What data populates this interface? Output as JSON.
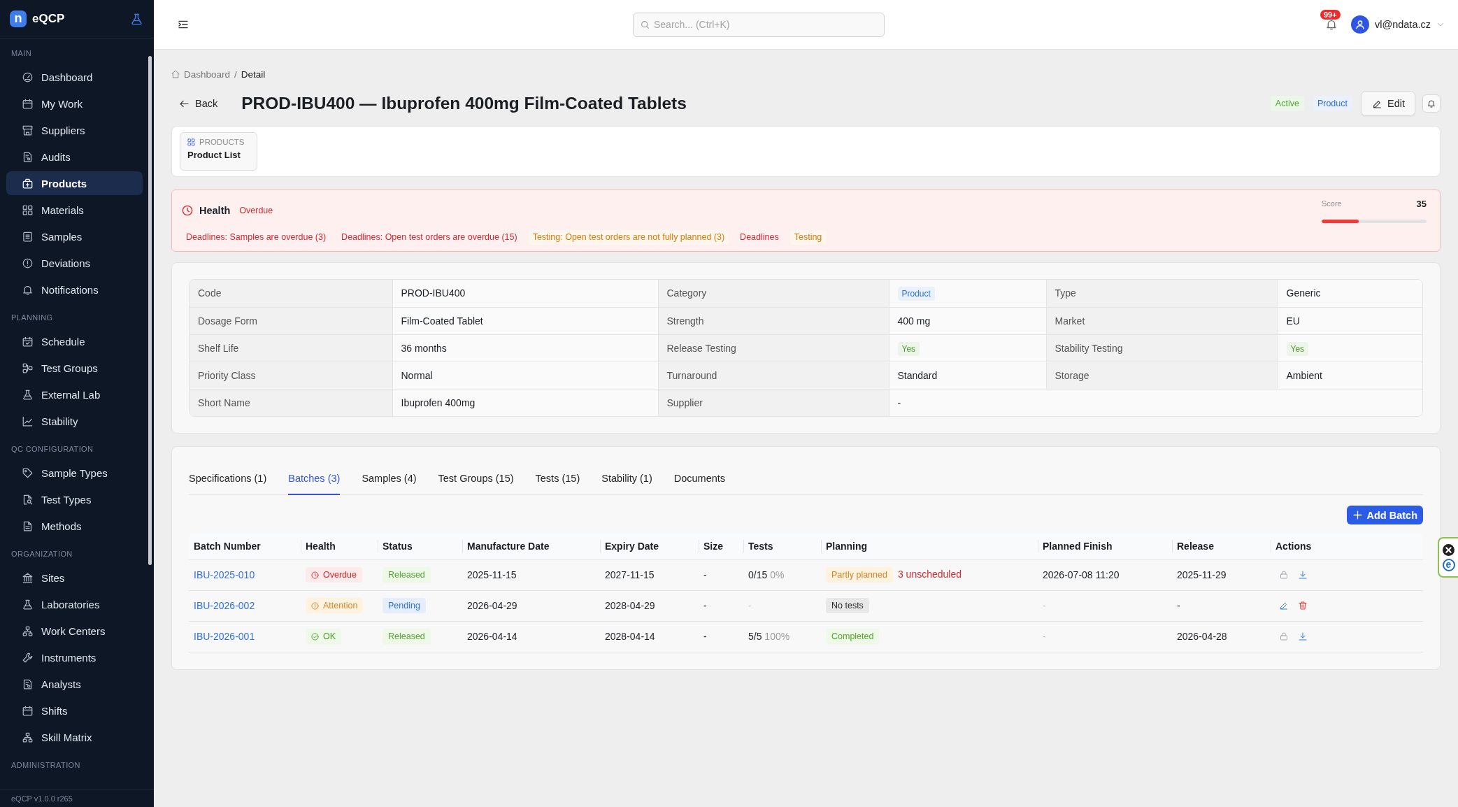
{
  "sidebar": {
    "logo_mark": "n",
    "app_name": "eQCP",
    "sections": [
      {
        "label": "MAIN",
        "items": [
          {
            "label": "Dashboard",
            "selected": false
          },
          {
            "label": "My Work",
            "selected": false
          },
          {
            "label": "Suppliers",
            "selected": false
          },
          {
            "label": "Audits",
            "selected": false
          },
          {
            "label": "Products",
            "selected": true
          },
          {
            "label": "Materials",
            "selected": false
          },
          {
            "label": "Samples",
            "selected": false
          },
          {
            "label": "Deviations",
            "selected": false
          },
          {
            "label": "Notifications",
            "selected": false
          }
        ]
      },
      {
        "label": "PLANNING",
        "items": [
          {
            "label": "Schedule",
            "selected": false
          },
          {
            "label": "Test Groups",
            "selected": false
          },
          {
            "label": "External Lab",
            "selected": false
          },
          {
            "label": "Stability",
            "selected": false
          }
        ]
      },
      {
        "label": "QC CONFIGURATION",
        "items": [
          {
            "label": "Sample Types",
            "selected": false
          },
          {
            "label": "Test Types",
            "selected": false
          },
          {
            "label": "Methods",
            "selected": false
          }
        ]
      },
      {
        "label": "ORGANIZATION",
        "items": [
          {
            "label": "Sites",
            "selected": false
          },
          {
            "label": "Laboratories",
            "selected": false
          },
          {
            "label": "Work Centers",
            "selected": false
          },
          {
            "label": "Instruments",
            "selected": false
          },
          {
            "label": "Analysts",
            "selected": false
          },
          {
            "label": "Shifts",
            "selected": false
          },
          {
            "label": "Skill Matrix",
            "selected": false
          }
        ]
      },
      {
        "label": "ADMINISTRATION"
      }
    ],
    "version": "eQCP v1.0.0 r265"
  },
  "topbar": {
    "search": {
      "placeholder": "Search... (Ctrl+K)"
    },
    "notification_count": "99+",
    "user": "vl@ndata.cz"
  },
  "breadcrumb": {
    "items": [
      "Dashboard",
      "Detail"
    ],
    "separator": "/"
  },
  "page": {
    "back": "Back",
    "title": "PROD-IBU400 — Ibuprofen 400mg Film-Coated Tablets",
    "badges": [
      {
        "label": "Active",
        "color": "#4ea82a"
      },
      {
        "label": "Product",
        "color": "#2f6fe4"
      }
    ],
    "edit": "Edit"
  },
  "subnav": {
    "section": "PRODUCTS",
    "link": "Product List"
  },
  "health": {
    "title": "Health",
    "status": "Overdue",
    "score_label": "Score",
    "score": "35",
    "level": 0.35,
    "issues": [
      {
        "text": "Deadlines: Samples are overdue (3)",
        "color": "#d9272e"
      },
      {
        "text": "Deadlines: Open test orders are overdue (15)",
        "color": "#d9272e"
      },
      {
        "text": "Testing: Open test orders are not fully planned (3)",
        "color": "#d97a06"
      },
      {
        "text": "Deadlines",
        "color": "#d9272e"
      },
      {
        "text": "Testing",
        "color": "#d97a06"
      }
    ]
  },
  "details": {
    "rows": [
      [
        {
          "label": "Code",
          "value": "PROD-IBU400",
          "kind": "text"
        },
        {
          "label": "Category",
          "value": "Product",
          "kind": "badge",
          "color": "#2f6fe4"
        },
        {
          "label": "Type",
          "value": "Generic",
          "kind": "text"
        }
      ],
      [
        {
          "label": "Dosage Form",
          "value": "Film-Coated Tablet",
          "kind": "text"
        },
        {
          "label": "Strength",
          "value": "400 mg",
          "kind": "text"
        },
        {
          "label": "Market",
          "value": "EU",
          "kind": "text"
        }
      ],
      [
        {
          "label": "Shelf Life",
          "value": "36 months",
          "kind": "text"
        },
        {
          "label": "Release Testing",
          "value": "Yes",
          "kind": "badge",
          "color": "#4e9a2e"
        },
        {
          "label": "Stability Testing",
          "value": "Yes",
          "kind": "badge",
          "color": "#4e9a2e"
        }
      ],
      [
        {
          "label": "Priority Class",
          "value": "Normal",
          "kind": "text"
        },
        {
          "label": "Turnaround",
          "value": "Standard",
          "kind": "text"
        },
        {
          "label": "Storage",
          "value": "Ambient",
          "kind": "text"
        }
      ],
      [
        {
          "label": "Short Name",
          "value": "Ibuprofen 400mg",
          "kind": "text"
        },
        {
          "label": "Supplier",
          "value": "-",
          "kind": "text"
        }
      ]
    ]
  },
  "tabs": [
    {
      "label": "Specifications (1)",
      "selected": false
    },
    {
      "label": "Batches (3)",
      "selected": true
    },
    {
      "label": "Samples (4)",
      "selected": false
    },
    {
      "label": "Test Groups (15)",
      "selected": false
    },
    {
      "label": "Tests (15)",
      "selected": false
    },
    {
      "label": "Stability (1)",
      "selected": false
    },
    {
      "label": "Documents",
      "selected": false
    }
  ],
  "add_button": "Add Batch",
  "batches": {
    "columns": [
      "Batch Number",
      "Health",
      "Status",
      "Manufacture Date",
      "Expiry Date",
      "Size",
      "Tests",
      "Planning",
      "Planned Finish",
      "Release",
      "Actions"
    ],
    "rows": [
      {
        "batch_number": "IBU-2025-010",
        "health": {
          "label": "Overdue",
          "kind": "overdue"
        },
        "status": {
          "label": "Released",
          "kind": "released"
        },
        "manufacture_date": "2025-11-15",
        "expiry_date": "2027-11-15",
        "size": "-",
        "tests": {
          "count": "0/15",
          "percent": "0%",
          "muted": false
        },
        "planning": {
          "label": "Partly planned",
          "kind": "partial",
          "note": "3 unscheduled"
        },
        "planned_finish": {
          "text": "2026-07-08 11:20",
          "muted": false
        },
        "release": "2025-11-29",
        "actions": [
          {
            "kind": "lock"
          },
          {
            "kind": "download"
          }
        ]
      },
      {
        "batch_number": "IBU-2026-002",
        "health": {
          "label": "Attention",
          "kind": "attention"
        },
        "status": {
          "label": "Pending",
          "kind": "pending"
        },
        "manufacture_date": "2026-04-29",
        "expiry_date": "2028-04-29",
        "size": "-",
        "tests": {
          "count": "-",
          "muted": true
        },
        "planning": {
          "label": "No tests",
          "kind": "none"
        },
        "planned_finish": {
          "text": "-",
          "muted": true
        },
        "release": "-",
        "actions": [
          {
            "kind": "edit"
          },
          {
            "kind": "delete"
          }
        ]
      },
      {
        "batch_number": "IBU-2026-001",
        "health": {
          "label": "OK",
          "kind": "ok"
        },
        "status": {
          "label": "Released",
          "kind": "released"
        },
        "manufacture_date": "2026-04-14",
        "expiry_date": "2028-04-14",
        "size": "-",
        "tests": {
          "count": "5/5",
          "percent": "100%",
          "muted": false
        },
        "planning": {
          "label": "Completed",
          "kind": "completed"
        },
        "planned_finish": {
          "text": "-",
          "muted": true
        },
        "release": "2026-04-28",
        "actions": [
          {
            "kind": "lock"
          },
          {
            "kind": "download"
          }
        ]
      }
    ]
  },
  "side_widget": {
    "logo_letter": "e"
  }
}
